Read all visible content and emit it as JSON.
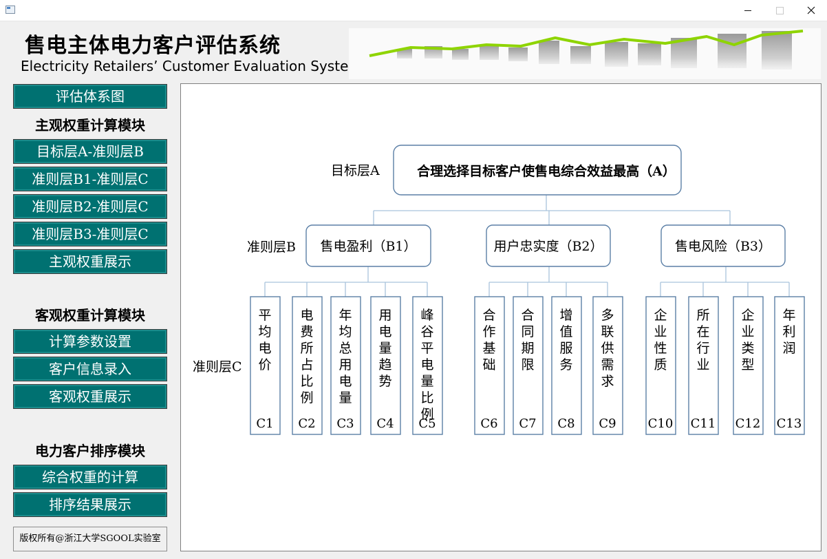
{
  "window": {
    "controls": {
      "minimize": "minimize-icon",
      "maximize": "maximize-icon",
      "close": "close-icon"
    }
  },
  "header": {
    "title_cn": "售电主体电力客户评估系统",
    "title_en": "Electricity Retailers’ Customer Evaluation System"
  },
  "colors": {
    "button_bg": "#007171",
    "button_text": "#ffffff",
    "box_stroke": "#5b7fa6",
    "connector": "#a9c3dc",
    "banner_green": "#8ed400"
  },
  "sidebar": {
    "eval_button": "评估体系图",
    "subjective_title": "主观权重计算模块",
    "subjective_items": [
      "目标层A-准则层B",
      "准则层B1-准则层C",
      "准则层B2-准则层C",
      "准则层B3-准则层C",
      "主观权重展示"
    ],
    "objective_title": "客观权重计算模块",
    "objective_items": [
      "计算参数设置",
      "客户信息录入",
      "客观权重展示"
    ],
    "ranking_title": "电力客户排序模块",
    "ranking_items": [
      "综合权重的计算",
      "排序结果展示"
    ],
    "copyright": "版权所有@浙江大学SGOOL实验室"
  },
  "diagram": {
    "level_a_label": "目标层A",
    "level_b_label": "准则层B",
    "level_c_label": "准则层C",
    "goal": "合理选择目标客户使售电综合效益最高（A）",
    "criteria": [
      {
        "label": "售电盈利（B1）",
        "indicators": [
          {
            "text": "平均电价",
            "code": "C1"
          },
          {
            "text": "电费所占比例",
            "code": "C2"
          },
          {
            "text": "年均总用电量",
            "code": "C3"
          },
          {
            "text": "用电量趋势",
            "code": "C4"
          },
          {
            "text": "峰谷平电量比例",
            "code": "C5"
          }
        ]
      },
      {
        "label": "用户忠实度（B2）",
        "indicators": [
          {
            "text": "合作基础",
            "code": "C6"
          },
          {
            "text": "合同期限",
            "code": "C7"
          },
          {
            "text": "增值服务",
            "code": "C8"
          },
          {
            "text": "多联供需求",
            "code": "C9"
          }
        ]
      },
      {
        "label": "售电风险（B3）",
        "indicators": [
          {
            "text": "企业性质",
            "code": "C10"
          },
          {
            "text": "所在行业",
            "code": "C11"
          },
          {
            "text": "企业类型",
            "code": "C12"
          },
          {
            "text": "年利润",
            "code": "C13"
          }
        ]
      }
    ]
  }
}
